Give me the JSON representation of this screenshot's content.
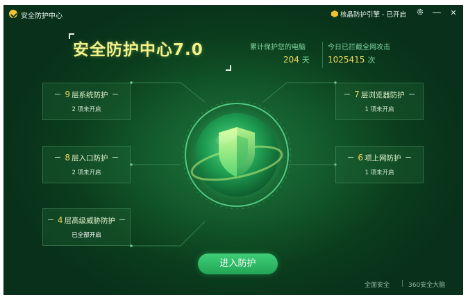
{
  "window": {
    "title": "安全防护中心",
    "engine_status": "核晶防护引擎 - 已开启",
    "settings_icon": "gear-icon",
    "minimize_label": "—",
    "close_label": "✕"
  },
  "brand": {
    "title": "安全防护中心7.0"
  },
  "stats": {
    "days_label": "累计保护您的电脑",
    "days_value": "204",
    "days_unit": "天",
    "attacks_label": "今日已拦截全网攻击",
    "attacks_value": "1025415",
    "attacks_unit": "次"
  },
  "cards": {
    "system": {
      "num": "9",
      "title": "层系统防护",
      "status": "2 项未开启"
    },
    "entry": {
      "num": "8",
      "title": "层入口防护",
      "status": "2 项未开启"
    },
    "threat": {
      "num": "4",
      "title": "层高级威胁防护",
      "status": "已全部开启"
    },
    "browser": {
      "num": "7",
      "title": "层浏览器防护",
      "status": "1 项未开启"
    },
    "internet": {
      "num": "6",
      "title": "项上网防护",
      "status": "1 项未开启"
    }
  },
  "actions": {
    "enter_label": "进入防护"
  },
  "footer": {
    "left": "全面安全",
    "right": "360安全大脑"
  },
  "colors": {
    "accent": "#2fbf66",
    "number": "#f2d95a",
    "brand_text": "#f2f28a",
    "background": "#0b3d1d"
  }
}
